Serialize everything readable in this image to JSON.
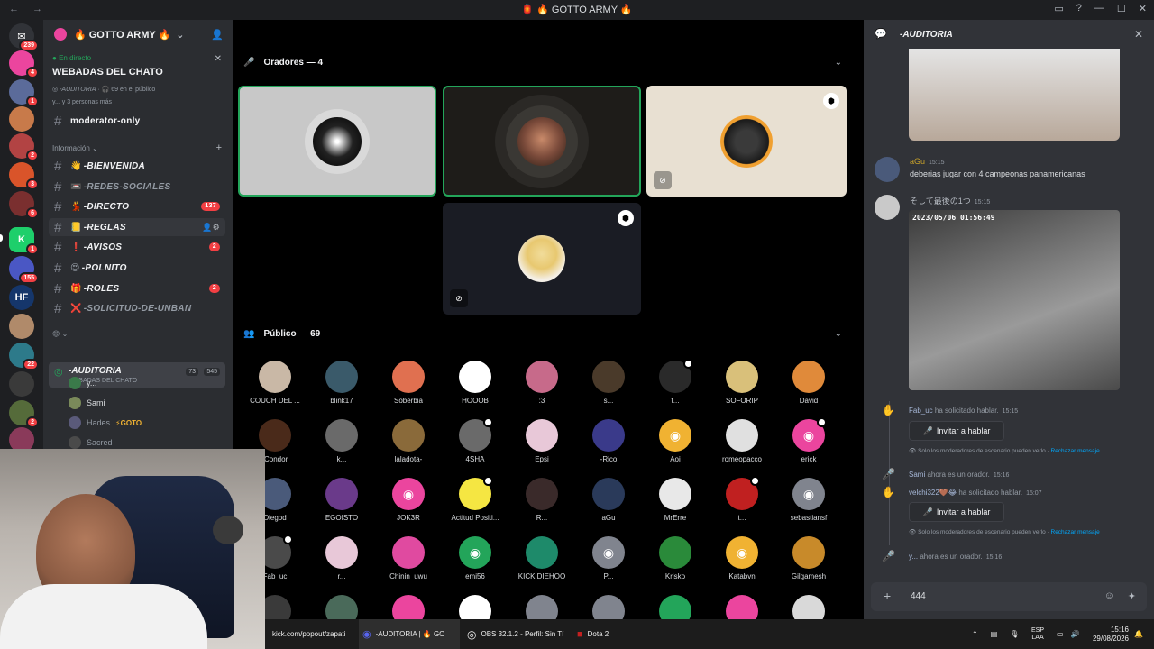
{
  "window": {
    "title": "🏮 🔥 GOTTO ARMY 🔥"
  },
  "rail": {
    "badges": [
      "239",
      "4",
      "1",
      "2",
      "3",
      "6",
      "1",
      "155",
      "22",
      "2"
    ],
    "server_initials": [
      "✉",
      "",
      "",
      "",
      "",
      "",
      "",
      "",
      "HF",
      "",
      "",
      "",
      ""
    ]
  },
  "server": {
    "name": "🔥 GOTTO ARMY 🔥",
    "live_label": "En directo",
    "event_title": "WEBADAS DEL CHATO",
    "event_channel": "-AUDITORIA",
    "event_audience": "69 en el público",
    "event_more": "y... y 3 personas más"
  },
  "channels": {
    "top": {
      "name": "moderator-only"
    },
    "category": "Información",
    "list": [
      {
        "emoji": "👋",
        "name": "-BIENVENIDA",
        "badge": ""
      },
      {
        "emoji": "📼",
        "name": "-REDES-SOCIALES",
        "badge": ""
      },
      {
        "emoji": "💃",
        "name": "-DIRECTO",
        "badge": "137"
      },
      {
        "emoji": "📒",
        "name": "-REGLAS",
        "badge": ""
      },
      {
        "emoji": "❗",
        "name": "-AVISOS",
        "badge": "2"
      },
      {
        "emoji": "😍",
        "name": "-POLNITO",
        "badge": ""
      },
      {
        "emoji": "🎁",
        "name": "-ROLES",
        "badge": "2"
      },
      {
        "emoji": "❌",
        "name": "-SOLICITUD-DE-UNBAN",
        "badge": ""
      }
    ],
    "stage": {
      "name": "-AUDITORIA",
      "sub": "WEBADAS DEL CHATO",
      "c1": "73",
      "c2": "545"
    },
    "voice_users": [
      "y...",
      "Sami",
      "Hades",
      "Sacred"
    ],
    "hades_tag": "GOTO"
  },
  "stage_view": {
    "speakers_label": "Oradores — 4",
    "audience_label": "Público — 69",
    "audience": [
      "COUCH DEL ...",
      "blink17",
      "Soberbia",
      "HOOOB",
      ":3",
      "s...",
      "t...",
      "SOFORIP",
      "David",
      ":Condor",
      "k...",
      "laladota-",
      "4SHA",
      "Epsi",
      "-Rico",
      "Aoi",
      "romeopacco",
      "erick",
      "Diegod",
      "EGOISTO",
      "JOK3R",
      "Actitud Positi...",
      "R...",
      "aGu",
      "MrErre",
      "t...",
      "sebastiansf",
      "Fab_uc",
      "r...",
      "Chinin_uwu",
      "emi56",
      "KICK.DIEHOO",
      "P...",
      "Krisko",
      "Katabvn",
      "Gilgamesh"
    ]
  },
  "chat": {
    "title": "-AUDITORIA",
    "m1": {
      "author": "aGu",
      "time": "15:15",
      "text": "deberias jugar con 4 campeonas panamericanas"
    },
    "m2": {
      "author": "そして最後の1つ",
      "time": "15:15",
      "cam_stamp": "2023/05/06 01:56:49"
    },
    "s1": {
      "user": "Fab_uc",
      "text": "ha solicitado hablar.",
      "time": "15:15"
    },
    "invite": "Invitar a hablar",
    "note": "Solo los moderadores de escenario pueden verlo",
    "reject": "Rechazar mensaje",
    "s2": {
      "user": "Sami",
      "text": "ahora es un orador.",
      "time": "15:16"
    },
    "s3": {
      "user": "velchi322🤎😂",
      "text": "ha solicitado hablar.",
      "time": "15:07"
    },
    "s4": {
      "user": "y...",
      "text": "ahora es un orador.",
      "time": "15:16"
    },
    "composer_value": "444"
  },
  "taskbar": {
    "item1": "kick.com/popout/zapati",
    "item2": "-AUDITORIA | 🔥 GO",
    "item3": "OBS 32.1.2 - Perfil: Sin Tí",
    "item4": "Dota 2",
    "lang": "ESP",
    "lang2": "LAA",
    "time": "15:16",
    "date": "29/08/2026"
  },
  "colors": {
    "accent": "#5865f2",
    "green": "#23a55a",
    "red": "#f23f43",
    "bg": "#313338"
  }
}
